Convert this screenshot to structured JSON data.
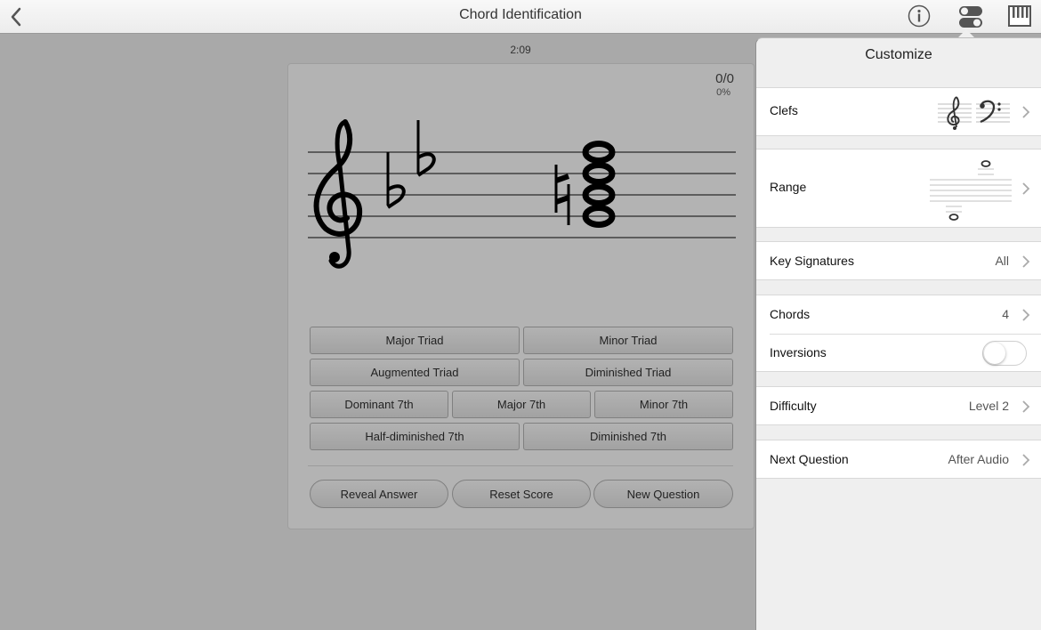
{
  "header": {
    "title": "Chord Identification"
  },
  "exercise": {
    "timer": "2:09",
    "score": "0/0",
    "score_percent": "0%"
  },
  "answers": {
    "major_triad": "Major Triad",
    "minor_triad": "Minor Triad",
    "augmented_triad": "Augmented Triad",
    "diminished_triad": "Diminished Triad",
    "dominant_7th": "Dominant 7th",
    "major_7th": "Major 7th",
    "minor_7th": "Minor 7th",
    "half_diminished_7th": "Half-diminished 7th",
    "diminished_7th": "Diminished 7th"
  },
  "actions": {
    "reveal_answer": "Reveal Answer",
    "reset_score": "Reset Score",
    "new_question": "New Question"
  },
  "customize": {
    "title": "Customize",
    "clefs": {
      "label": "Clefs"
    },
    "range": {
      "label": "Range"
    },
    "key_signatures": {
      "label": "Key Signatures",
      "value": "All"
    },
    "chords": {
      "label": "Chords",
      "value": "4"
    },
    "inversions": {
      "label": "Inversions",
      "enabled": false
    },
    "difficulty": {
      "label": "Difficulty",
      "value": "Level 2"
    },
    "next_question": {
      "label": "Next Question",
      "value": "After Audio"
    }
  },
  "icons": {
    "back": "chevron-left-icon",
    "info": "info-icon",
    "customize": "toggles-icon",
    "keyboard": "piano-keyboard-icon"
  }
}
